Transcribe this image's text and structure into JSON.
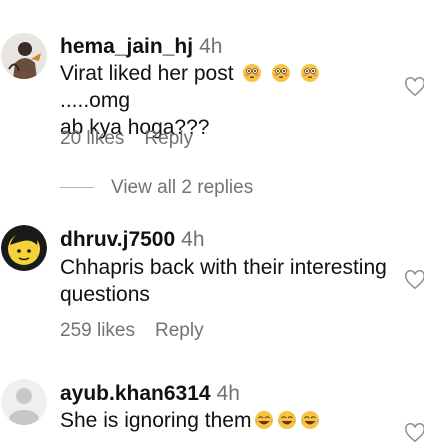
{
  "comments": [
    {
      "username": "hema_jain_hj",
      "time": "4h",
      "text_main": "Virat liked her post",
      "text_tail": ".....omg",
      "text_line2": "ab kya hoga???",
      "likes": "20 likes",
      "reply": "Reply",
      "emojis": [
        "flushed-face",
        "flushed-face",
        "flushed-face"
      ]
    },
    {
      "username": "dhruv.j7500",
      "time": "4h",
      "text": "Chhapris back with their interesting questions",
      "likes": "259 likes",
      "reply": "Reply"
    },
    {
      "username": "ayub.khan6314",
      "time": "4h",
      "text_main": "She is ignoring them",
      "emojis": [
        "laughing-face",
        "laughing-face",
        "laughing-face"
      ]
    }
  ],
  "view_replies": "View all 2 replies",
  "colors": {
    "secondary_text": "#737373",
    "primary_text": "#111111",
    "background": "#ffffff"
  }
}
